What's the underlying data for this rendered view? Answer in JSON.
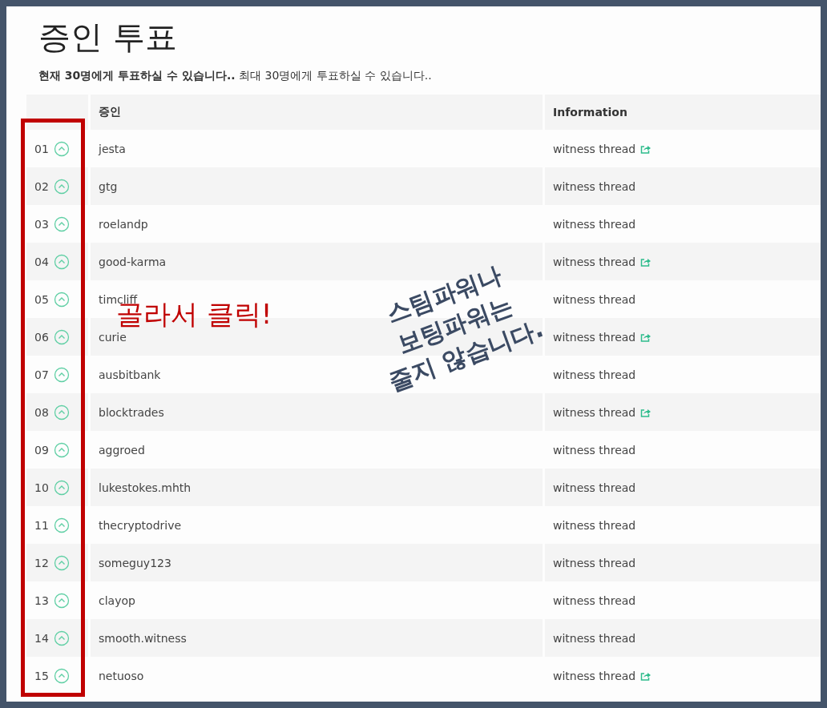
{
  "title": "증인 투표",
  "subtitle": "**현재 30명에게 투표하실 수 있습니다..** 최대 30명에게 투표하실 수 있습니다..",
  "table": {
    "columns": [
      "증인",
      "Information"
    ],
    "rows": [
      {
        "rank": "01",
        "name": "jesta",
        "info": "witness thread",
        "link_icon": true
      },
      {
        "rank": "02",
        "name": "gtg",
        "info": "witness thread",
        "link_icon": false
      },
      {
        "rank": "03",
        "name": "roelandp",
        "info": "witness thread",
        "link_icon": false
      },
      {
        "rank": "04",
        "name": "good-karma",
        "info": "witness thread",
        "link_icon": true
      },
      {
        "rank": "05",
        "name": "timcliff",
        "info": "witness thread",
        "link_icon": false
      },
      {
        "rank": "06",
        "name": "curie",
        "info": "witness thread",
        "link_icon": true
      },
      {
        "rank": "07",
        "name": "ausbitbank",
        "info": "witness thread",
        "link_icon": false
      },
      {
        "rank": "08",
        "name": "blocktrades",
        "info": "witness thread",
        "link_icon": true
      },
      {
        "rank": "09",
        "name": "aggroed",
        "info": "witness thread",
        "link_icon": false
      },
      {
        "rank": "10",
        "name": "lukestokes.mhth",
        "info": "witness thread",
        "link_icon": false
      },
      {
        "rank": "11",
        "name": "thecryptodrive",
        "info": "witness thread",
        "link_icon": false
      },
      {
        "rank": "12",
        "name": "someguy123",
        "info": "witness thread",
        "link_icon": false
      },
      {
        "rank": "13",
        "name": "clayop",
        "info": "witness thread",
        "link_icon": false
      },
      {
        "rank": "14",
        "name": "smooth.witness",
        "info": "witness thread",
        "link_icon": false
      },
      {
        "rank": "15",
        "name": "netuoso",
        "info": "witness thread",
        "link_icon": true
      }
    ]
  },
  "annotations": {
    "click_hint": "골라서 클릭!",
    "note": "스팀파워나\n보팅파워는\n줄지 않습니다."
  }
}
